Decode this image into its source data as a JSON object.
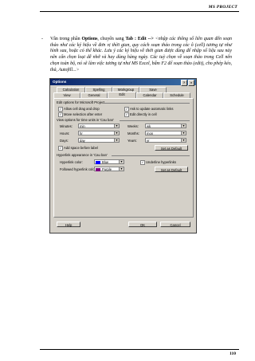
{
  "header": {
    "title": "MS PROJECT"
  },
  "paragraph": {
    "bullet": "-",
    "intro": "Vẫn trong phần ",
    "options_bold": "Options",
    "mid": ", chuyển sang ",
    "tab_bold": "Tab : Edit -->",
    "rest": " <nhập các thông số liên quan đến soạn thảo như các ký hiệu về đơn vị thời gian, quy cách soạn thảo trong các ô (cell) tương tự như hình sau, hoặc có thể khác. Lưu ý các ký hiệu về thời gian được dùng để nhập số liệu sau này nên cẩn chọn loại dễ nhớ và hay dùng hàng ngày. Các tuỳ chọn về soạn thảo trong Cell nên chọn toàn bộ, nó sẽ làm việc tương tự như MS Excel, bấm F2 để soạn thảo (edit), cho phép kéo, thả, Autofill...>"
  },
  "dialog": {
    "title": "Options",
    "title_buttons": {
      "help": "?",
      "close": "×"
    },
    "tabs_row1": [
      "Calculation",
      "Spelling",
      "Workgroup",
      "Save"
    ],
    "tabs_row2": [
      "View",
      "General",
      "Edit",
      "Calendar",
      "Schedule"
    ],
    "active_tab": "Edit",
    "edit_section": "Edit options for Microsoft Project",
    "checkboxes": {
      "drag_drop": {
        "label": "Allow cell drag and drop",
        "checked": true
      },
      "move_selection": {
        "label": "Move selection after enter",
        "checked": true
      },
      "ask_update": {
        "label": "Ask to update automatic links",
        "checked": true
      },
      "edit_in_cell": {
        "label": "Edit directly in cell",
        "checked": true
      }
    },
    "view_section": "View options for time units in 'Cau ban'",
    "time_units": {
      "minutes": {
        "label": "Minutes:",
        "value": "min"
      },
      "hours": {
        "label": "Hours:",
        "value": "hr"
      },
      "days": {
        "label": "Days:",
        "value": "day"
      },
      "weeks": {
        "label": "Weeks:",
        "value": "wk"
      },
      "months": {
        "label": "Months:",
        "value": "mon"
      },
      "years": {
        "label": "Years:",
        "value": "yr"
      }
    },
    "add_space": {
      "label": "Add space before label",
      "checked": true
    },
    "set_default_1": "Set as Default",
    "hyperlink_section": "Hyperlink appearance in 'Cau ban'",
    "hyperlink_color": {
      "label": "Hyperlink color:",
      "value": "Blue",
      "swatch": "#0000ff"
    },
    "followed_color": {
      "label": "Followed hyperlink color:",
      "value": "Purple",
      "swatch": "#800080"
    },
    "underline": {
      "label": "Underline hyperlinks",
      "checked": true
    },
    "set_default_2": "Set as Default",
    "help_button": "Help",
    "ok_button": "OK",
    "cancel_button": "Cancel"
  },
  "footer": {
    "page_number": "110"
  }
}
